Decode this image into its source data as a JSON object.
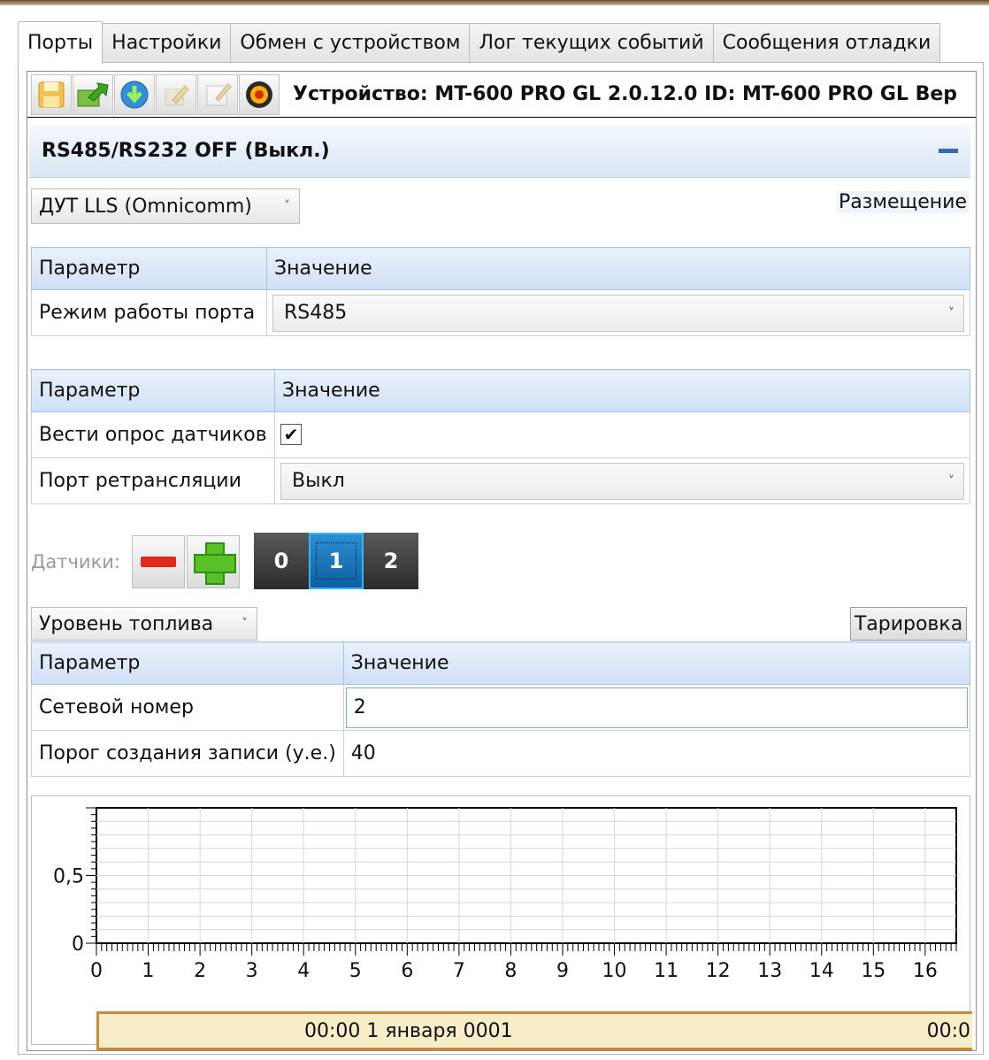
{
  "tabs": [
    "Порты",
    "Настройки",
    "Обмен с устройством",
    "Лог текущих событий",
    "Сообщения отладки"
  ],
  "toolbar": {
    "buttons": [
      "save-icon",
      "export-icon",
      "download-icon",
      "pencil-icon",
      "notepad-icon",
      "record-icon"
    ],
    "device_text": "Устройство: MT-600 PRO GL 2.0.12.0 ID: MT-600 PRO GL Вер"
  },
  "section": {
    "title": "RS485/RS232 OFF (Выкл.)"
  },
  "sensor_type": {
    "selected": "ДУТ LLS (Omnicomm)"
  },
  "placement_label": "Размещение",
  "grid1": {
    "headers": [
      "Параметр",
      "Значение"
    ],
    "rows": [
      {
        "param": "Режим работы порта",
        "value": "RS485"
      }
    ]
  },
  "grid2": {
    "headers": [
      "Параметр",
      "Значение"
    ],
    "rows": [
      {
        "param": "Вести опрос датчиков",
        "checked": true
      },
      {
        "param": "Порт ретрансляции",
        "value": "Выкл"
      }
    ]
  },
  "sensors": {
    "label": "Датчики:",
    "items": [
      "0",
      "1",
      "2"
    ],
    "selected": "1"
  },
  "measure": {
    "selected": "Уровень топлива",
    "tarir_label": "Тарировка"
  },
  "grid3": {
    "headers": [
      "Параметр",
      "Значение"
    ],
    "rows": [
      {
        "param": "Сетевой номер",
        "value": "2"
      },
      {
        "param": "Порог создания записи (у.е.)",
        "value": "40"
      }
    ]
  },
  "chart_data": {
    "type": "line",
    "x_ticks": [
      "0",
      "1",
      "2",
      "3",
      "4",
      "5",
      "6",
      "7",
      "8",
      "9",
      "10",
      "11",
      "12",
      "13",
      "14",
      "15",
      "16"
    ],
    "y_ticks": [
      "0",
      "0,5"
    ],
    "xlim": [
      0,
      16.6
    ],
    "ylim": [
      0,
      1
    ],
    "grid": true,
    "series": []
  },
  "timeline": {
    "start": "00:00 1 января 0001",
    "end_partial": "00:0"
  },
  "colors": {
    "accent": "#2f6db5",
    "timebar_fill": "#f7edc9",
    "timebar_border": "#c98a3c"
  }
}
